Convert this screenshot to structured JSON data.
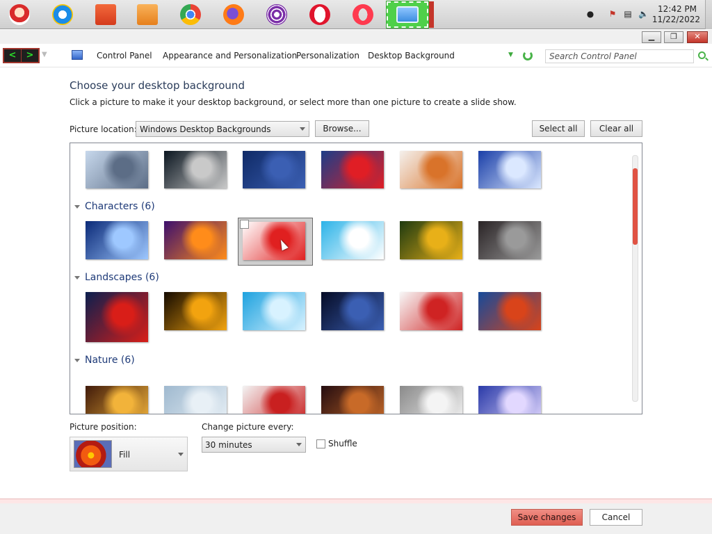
{
  "taskbar": {
    "apps": [
      {
        "name": "santa-app",
        "color": "#d92b2b"
      },
      {
        "name": "internet-explorer",
        "color": "#1a8ce8"
      },
      {
        "name": "file-explorer",
        "color": "#e24b2b"
      },
      {
        "name": "media-player",
        "color": "#f08c1d"
      },
      {
        "name": "chrome",
        "color": "#34a853"
      },
      {
        "name": "firefox",
        "color": "#ff7b17"
      },
      {
        "name": "tor-browser",
        "color": "#7b2fa8"
      },
      {
        "name": "opera",
        "color": "#e0152d"
      },
      {
        "name": "opera-gx",
        "color": "#ff3a4f"
      },
      {
        "name": "control-panel",
        "color": "#3d8de0"
      }
    ],
    "clock": {
      "time": "12:42 PM",
      "date": "11/22/2022"
    }
  },
  "address": {
    "crumbs": [
      "Control Panel",
      "Appearance and Personalization",
      "Personalization",
      "Desktop Background"
    ],
    "search_placeholder": "Search Control Panel"
  },
  "main": {
    "title": "Choose your desktop background",
    "description": "Click a picture to make it your desktop background, or select more than one picture to create a slide show.",
    "location_label": "Picture location:",
    "location_value": "Windows Desktop Backgrounds",
    "browse_label": "Browse...",
    "select_all_label": "Select all",
    "clear_all_label": "Clear all"
  },
  "gallery": {
    "groups": [
      {
        "title": "",
        "thumbs": [
          [
            "#c7d8ec",
            "#5c6d86"
          ],
          [
            "#0b1620",
            "#c9c9c9"
          ],
          [
            "#0f2a66",
            "#3b5fb3"
          ],
          [
            "#1c3d88",
            "#e01e25"
          ],
          [
            "#f4f0ec",
            "#d9732a"
          ],
          [
            "#1a3fa8",
            "#dbe8ff"
          ]
        ]
      },
      {
        "title": "Characters (6)",
        "thumbs": [
          [
            "#0b2a78",
            "#9ec8ff"
          ],
          [
            "#3c0f6e",
            "#ff8c1a"
          ],
          [
            "#ffffff",
            "#e02020"
          ],
          [
            "#2cb3e8",
            "#ffffff"
          ],
          [
            "#1e3a10",
            "#e8b018"
          ],
          [
            "#2a2426",
            "#9a9a9a"
          ]
        ]
      },
      {
        "title": "Landscapes (6)",
        "thumbs": [
          [
            "#0b1f4f",
            "#d91e18"
          ],
          [
            "#140a00",
            "#f2a30f"
          ],
          [
            "#1ea2df",
            "#d8f2ff"
          ],
          [
            "#050b25",
            "#3b5fb3"
          ],
          [
            "#f7f7f7",
            "#cf2323"
          ],
          [
            "#164a9a",
            "#d9441a"
          ]
        ]
      },
      {
        "title": "Nature (6)",
        "thumbs": [
          [
            "#401a0a",
            "#f2b33a"
          ],
          [
            "#9fb9cf",
            "#e8f0f6"
          ],
          [
            "#f3f3f3",
            "#c92020"
          ],
          [
            "#240c10",
            "#c86a28"
          ],
          [
            "#8a8a8a",
            "#f4f4f4"
          ],
          [
            "#2a3aa8",
            "#e2d8ff"
          ]
        ]
      }
    ]
  },
  "options": {
    "position_label": "Picture position:",
    "position_value": "Fill",
    "change_label": "Change picture every:",
    "interval_value": "30 minutes",
    "shuffle_label": "Shuffle"
  },
  "footer": {
    "save_label": "Save changes",
    "cancel_label": "Cancel"
  },
  "colors": {
    "accent": "#e05344",
    "title_text": "#2a3c5a"
  }
}
